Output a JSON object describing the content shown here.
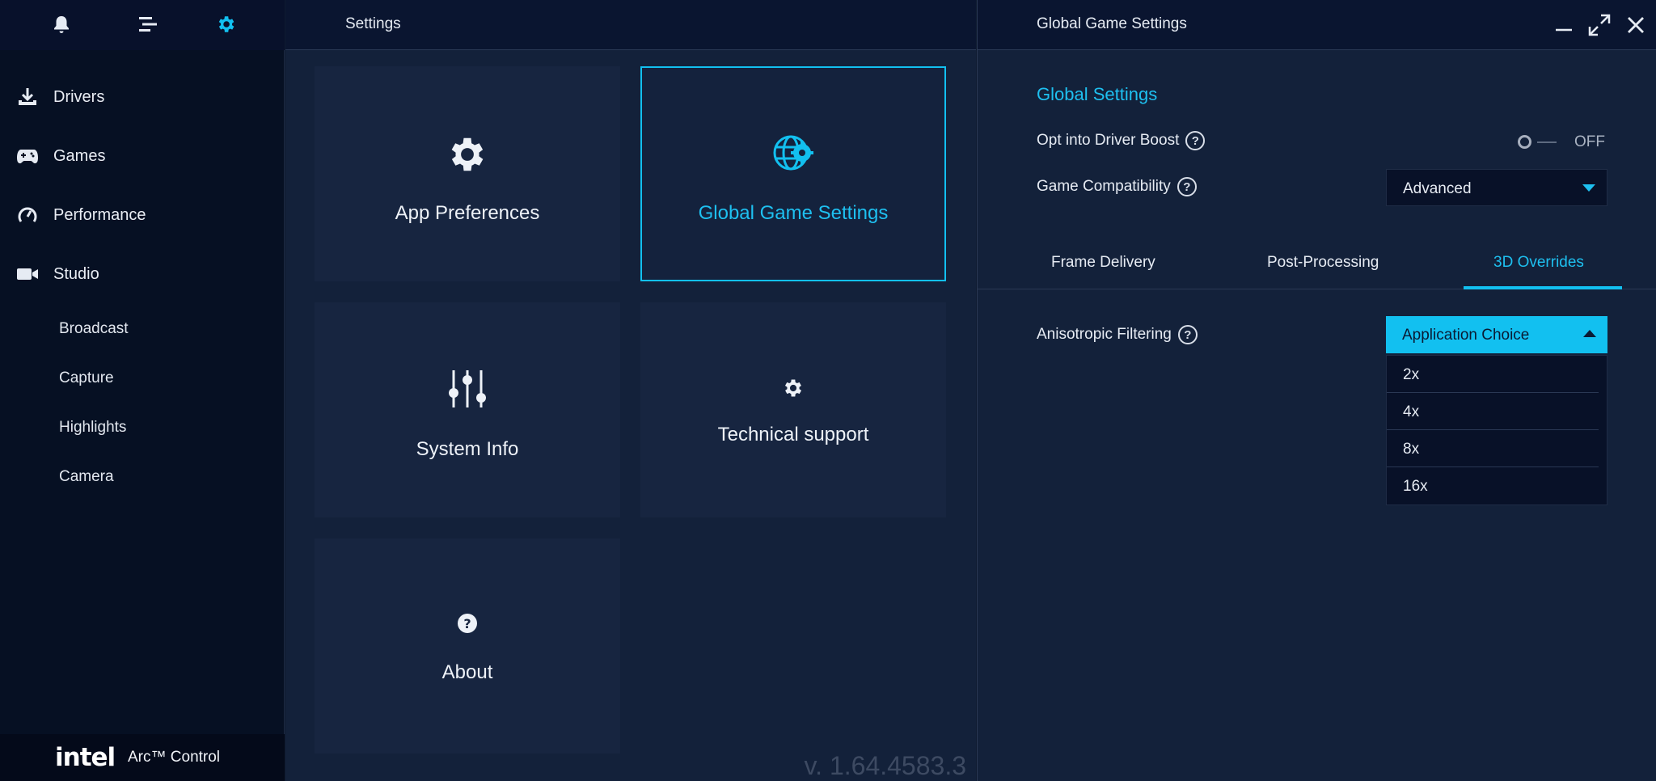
{
  "sidebar": {
    "top_icons": [
      "bell-icon",
      "menu-icon",
      "gear-icon"
    ],
    "nav": [
      {
        "label": "Drivers",
        "icon": "download-icon"
      },
      {
        "label": "Games",
        "icon": "gamepad-icon"
      },
      {
        "label": "Performance",
        "icon": "gauge-icon"
      },
      {
        "label": "Studio",
        "icon": "camera-icon"
      }
    ],
    "studio_items": [
      "Broadcast",
      "Capture",
      "Highlights",
      "Camera"
    ],
    "brand_logo": "intel",
    "brand_product": "Arc™ Control"
  },
  "center": {
    "title": "Settings",
    "tiles": [
      {
        "label": "App Preferences",
        "icon": "gear-icon"
      },
      {
        "label": "Global Game Settings",
        "icon": "globe-gear-icon"
      },
      {
        "label": "System Info",
        "icon": "sliders-icon"
      },
      {
        "label": "Technical support",
        "icon": "small-gear-icon"
      },
      {
        "label": "About",
        "icon": "question-icon"
      }
    ],
    "version": "v. 1.64.4583.3"
  },
  "right": {
    "title": "Global Game Settings",
    "section_title": "Global Settings",
    "driver_boost_label": "Opt into Driver Boost",
    "driver_boost_state": "OFF",
    "game_compat_label": "Game Compatibility",
    "game_compat_value": "Advanced",
    "tabs": [
      "Frame Delivery",
      "Post-Processing",
      "3D Overrides"
    ],
    "active_tab": "3D Overrides",
    "aniso_label": "Anisotropic Filtering",
    "aniso_value": "Application Choice",
    "aniso_options": [
      "2x",
      "4x",
      "8x",
      "16x"
    ],
    "help_glyph": "?"
  },
  "colors": {
    "accent": "#12c0f0",
    "sidebar_bg": "#061023",
    "panel_bg": "#13213a",
    "tile_bg": "#172540"
  }
}
